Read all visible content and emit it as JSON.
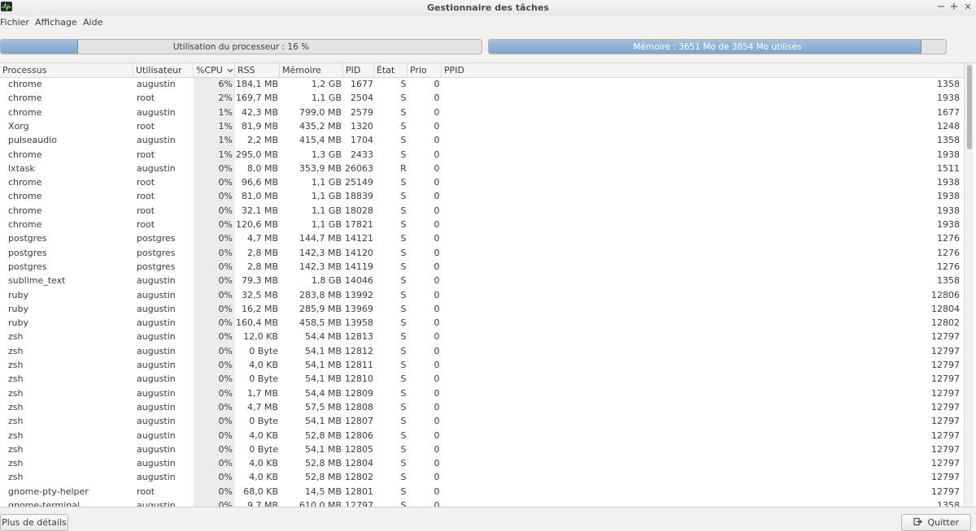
{
  "window": {
    "title": "Gestionnaire des tâches",
    "controls": {
      "minimize": "−",
      "maximize": "+",
      "close": "✕"
    }
  },
  "menu": {
    "items": [
      "Fichier",
      "Affichage",
      "Aide"
    ]
  },
  "cpu": {
    "label": "Utilisation du processeur : 16 %",
    "fraction": 0.16
  },
  "memory": {
    "label": "Mémoire : 3651 Mo de 3854 Mo utilisés",
    "fraction": 0.947
  },
  "table": {
    "columns": [
      "Processus",
      "Utilisateur",
      "%CPU",
      "RSS",
      "Mémoire",
      "PID",
      "État",
      "Prio",
      "PPID"
    ],
    "sorted_column": "%CPU",
    "sort_icon": "chevron-down-icon",
    "rows": [
      [
        "chrome",
        "augustin",
        "6%",
        "184,1 MB",
        "1,2 GB",
        "1677",
        "S",
        "0",
        "1358"
      ],
      [
        "chrome",
        "root",
        "2%",
        "169,7 MB",
        "1,1 GB",
        "2504",
        "S",
        "0",
        "1938"
      ],
      [
        "chrome",
        "augustin",
        "1%",
        "42,3 MB",
        "799,0 MB",
        "2579",
        "S",
        "0",
        "1677"
      ],
      [
        "Xorg",
        "root",
        "1%",
        "81,9 MB",
        "435,2 MB",
        "1320",
        "S",
        "0",
        "1248"
      ],
      [
        "pulseaudio",
        "augustin",
        "1%",
        "2,2 MB",
        "415,4 MB",
        "1704",
        "S",
        "0",
        "1358"
      ],
      [
        "chrome",
        "root",
        "1%",
        "295,0 MB",
        "1,3 GB",
        "2433",
        "S",
        "0",
        "1938"
      ],
      [
        "lxtask",
        "augustin",
        "0%",
        "8,0 MB",
        "353,9 MB",
        "26063",
        "R",
        "0",
        "1511"
      ],
      [
        "chrome",
        "root",
        "0%",
        "96,6 MB",
        "1,1 GB",
        "25149",
        "S",
        "0",
        "1938"
      ],
      [
        "chrome",
        "root",
        "0%",
        "81,0 MB",
        "1,1 GB",
        "18839",
        "S",
        "0",
        "1938"
      ],
      [
        "chrome",
        "root",
        "0%",
        "32,1 MB",
        "1,1 GB",
        "18028",
        "S",
        "0",
        "1938"
      ],
      [
        "chrome",
        "root",
        "0%",
        "120,6 MB",
        "1,1 GB",
        "17821",
        "S",
        "0",
        "1938"
      ],
      [
        "postgres",
        "postgres",
        "0%",
        "4,7 MB",
        "144,7 MB",
        "14121",
        "S",
        "0",
        "1276"
      ],
      [
        "postgres",
        "postgres",
        "0%",
        "2,8 MB",
        "142,3 MB",
        "14120",
        "S",
        "0",
        "1276"
      ],
      [
        "postgres",
        "postgres",
        "0%",
        "2,8 MB",
        "142,3 MB",
        "14119",
        "S",
        "0",
        "1276"
      ],
      [
        "sublime_text",
        "augustin",
        "0%",
        "79,3 MB",
        "1,8 GB",
        "14046",
        "S",
        "0",
        "1358"
      ],
      [
        "ruby",
        "augustin",
        "0%",
        "32,5 MB",
        "283,8 MB",
        "13992",
        "S",
        "0",
        "12806"
      ],
      [
        "ruby",
        "augustin",
        "0%",
        "16,2 MB",
        "285,9 MB",
        "13969",
        "S",
        "0",
        "12804"
      ],
      [
        "ruby",
        "augustin",
        "0%",
        "160,4 MB",
        "458,5 MB",
        "13958",
        "S",
        "0",
        "12802"
      ],
      [
        "zsh",
        "augustin",
        "0%",
        "12,0 KB",
        "54,4 MB",
        "12813",
        "S",
        "0",
        "12797"
      ],
      [
        "zsh",
        "augustin",
        "0%",
        "0 Byte",
        "54,1 MB",
        "12812",
        "S",
        "0",
        "12797"
      ],
      [
        "zsh",
        "augustin",
        "0%",
        "4,0 KB",
        "54,1 MB",
        "12811",
        "S",
        "0",
        "12797"
      ],
      [
        "zsh",
        "augustin",
        "0%",
        "0 Byte",
        "54,1 MB",
        "12810",
        "S",
        "0",
        "12797"
      ],
      [
        "zsh",
        "augustin",
        "0%",
        "1,7 MB",
        "54,4 MB",
        "12809",
        "S",
        "0",
        "12797"
      ],
      [
        "zsh",
        "augustin",
        "0%",
        "4,7 MB",
        "57,5 MB",
        "12808",
        "S",
        "0",
        "12797"
      ],
      [
        "zsh",
        "augustin",
        "0%",
        "0 Byte",
        "54,1 MB",
        "12807",
        "S",
        "0",
        "12797"
      ],
      [
        "zsh",
        "augustin",
        "0%",
        "4,0 KB",
        "52,8 MB",
        "12806",
        "S",
        "0",
        "12797"
      ],
      [
        "zsh",
        "augustin",
        "0%",
        "0 Byte",
        "54,1 MB",
        "12805",
        "S",
        "0",
        "12797"
      ],
      [
        "zsh",
        "augustin",
        "0%",
        "4,0 KB",
        "52,8 MB",
        "12804",
        "S",
        "0",
        "12797"
      ],
      [
        "zsh",
        "augustin",
        "0%",
        "4,0 KB",
        "52,8 MB",
        "12802",
        "S",
        "0",
        "12797"
      ],
      [
        "gnome-pty-helper",
        "root",
        "0%",
        "68,0 KB",
        "14,5 MB",
        "12801",
        "S",
        "0",
        "12797"
      ],
      [
        "gnome-terminal",
        "augustin",
        "0%",
        "9,7 MB",
        "610,0 MB",
        "12797",
        "S",
        "0",
        "1358"
      ]
    ]
  },
  "buttons": {
    "details": "Plus de détails",
    "quit": "Quitter",
    "quit_icon": "exit-icon"
  }
}
